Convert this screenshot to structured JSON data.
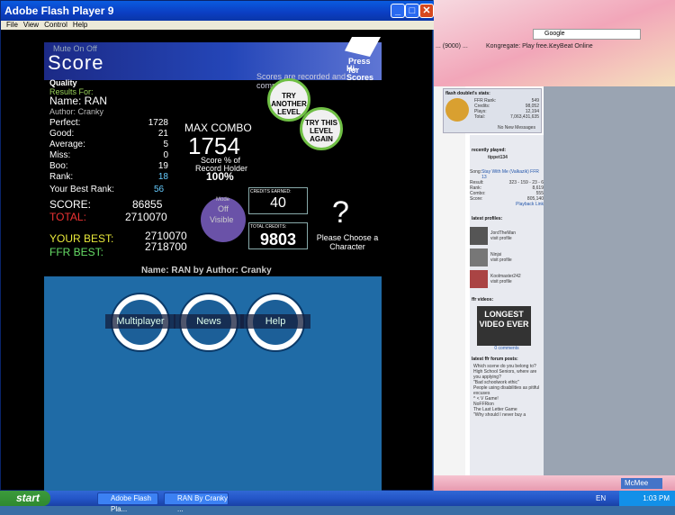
{
  "flash_window": {
    "title": "Adobe Flash Player 9",
    "menu": [
      "File",
      "View",
      "Control",
      "Help"
    ]
  },
  "game": {
    "mute": "Mute On Off",
    "title": "Score",
    "press_for": "Press for",
    "hi_scores": "Hi-Scores",
    "recorded": "Scores are recorded and compared ...",
    "quality": "Quality",
    "results_for": "Results For:",
    "name_line": "Name: RAN",
    "author_line": "Author: Cranky",
    "stats": [
      {
        "label": "Perfect:",
        "value": "1728"
      },
      {
        "label": "Good:",
        "value": "21"
      },
      {
        "label": "Average:",
        "value": "5"
      },
      {
        "label": "Miss:",
        "value": "0"
      },
      {
        "label": "Boo:",
        "value": "19"
      },
      {
        "label": "Rank:",
        "value": "18"
      }
    ],
    "best_rank_label": "Your Best Rank:",
    "best_rank": "56",
    "score_label": "SCORE:",
    "score": "86855",
    "total_label": "TOTAL:",
    "total": "2710070",
    "your_best_label": "YOUR BEST:",
    "your_best": "2710070",
    "ffr_best_label": "FFR BEST:",
    "ffr_best": "2718700",
    "max_combo_label": "MAX COMBO",
    "max_combo": "1754",
    "score_pct_label": "Score % of",
    "record_holder": "Record Holder",
    "pct": "100%",
    "mode_label": "Mode",
    "mode_off": "Off",
    "mode_visible": "Visible",
    "credits_earned_label": "CREDITS EARNED:",
    "credits_earned": "40",
    "total_credits_label": "TOTAL CREDITS:",
    "total_credits": "9803",
    "question": "?",
    "choose_char": "Please Choose a Character",
    "song_line": "Name: RAN by Author: Cranky",
    "try_another": "TRY ANOTHER LEVEL",
    "try_again": "TRY THIS LEVEL AGAIN",
    "buttons": {
      "multiplayer": "Multiplayer",
      "news": "News",
      "help": "Help"
    }
  },
  "browser": {
    "search_engine": "Google",
    "bookmarks": [
      "... (9000) ...",
      "Kongregate: Play free...",
      "KeyBeat Online"
    ],
    "stats_title": "flash doublet's stats:",
    "stat_rows": [
      {
        "k": "FFR Rank:",
        "v": "549"
      },
      {
        "k": "Credits:",
        "v": "98,052"
      },
      {
        "k": "Plays:",
        "v": "12,194"
      },
      {
        "k": "Total:",
        "v": "7,063,431,635"
      }
    ],
    "msg": "No New Messages",
    "recently_played": "recently played:",
    "rp_user": "tippet134",
    "song_lbl": "Song:",
    "song": "Stay With Me (Valkazik) FFR 13",
    "result_lbl": "Result:",
    "result": "323 - 159 - 23 - 6",
    "rank_lbl": "Rank:",
    "rank": "8,619",
    "combo_lbl": "Combo:",
    "combo": "555",
    "score_lbl": "Score:",
    "score": "805,140",
    "playback": "Playback Link",
    "latest_profiles": "latest profiles:",
    "profiles": [
      {
        "name": "JordTheMan",
        "sub": "visit profile"
      },
      {
        "name": "Ninjsi",
        "sub": "visit profile"
      },
      {
        "name": "Koolmaster242",
        "sub": "visit profile"
      }
    ],
    "videos": "ffr videos:",
    "video_text": "LONGEST VIDEO EVER",
    "comments": "0 comments",
    "forum": "latest ffr forum posts:",
    "posts": [
      "Which scene do you belong to?",
      "High School Seniors, where are you applying?",
      "\"Bad schoolwork ethic\"",
      "People using disabilities as pitiful excuses",
      "^ < V Game!",
      "NoFFRion",
      "The Last Letter Game",
      "\"Why should I never buy a"
    ]
  },
  "taskbar": {
    "start": "start",
    "tasks": [
      "Adobe Flash Pla...",
      "RAN By Cranky ..."
    ],
    "lang": "EN",
    "user": "McMee",
    "time": "1:03 PM"
  }
}
